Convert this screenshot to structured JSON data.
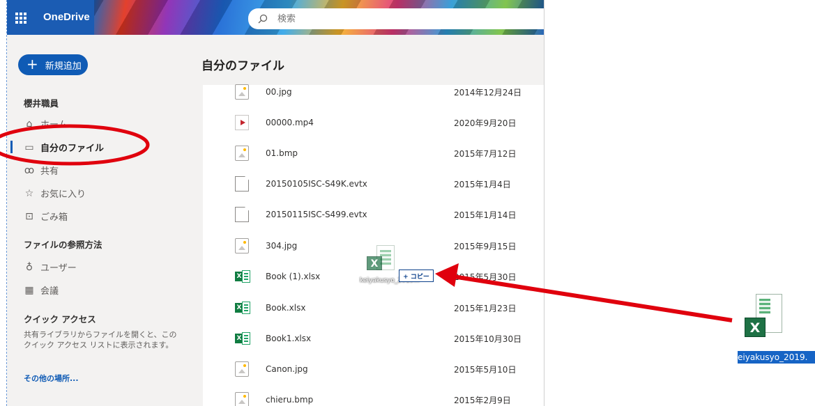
{
  "app": {
    "brand": "OneDrive"
  },
  "search": {
    "placeholder": "検索"
  },
  "new_button": {
    "label": "新規追加"
  },
  "sidebar": {
    "user_heading": "櫻井職員",
    "items": [
      {
        "label": "ホーム",
        "icon": "home-icon"
      },
      {
        "label": "自分のファイル",
        "icon": "folder-icon",
        "active": true
      },
      {
        "label": "共有",
        "icon": "people-icon"
      },
      {
        "label": "お気に入り",
        "icon": "star-icon"
      },
      {
        "label": "ごみ箱",
        "icon": "trash-icon"
      }
    ],
    "browse_heading": "ファイルの参照方法",
    "browse_items": [
      {
        "label": "ユーザー",
        "icon": "user-icon"
      },
      {
        "label": "会議",
        "icon": "meeting-icon"
      }
    ],
    "quick_heading": "クイック アクセス",
    "quick_desc": "共有ライブラリからファイルを開くと、このクイック アクセス リストに表示されます。",
    "other_link": "その他の場所..."
  },
  "main": {
    "title": "自分のファイル",
    "files": [
      {
        "name": "00.jpg",
        "date": "2014年12月24日",
        "type": "image"
      },
      {
        "name": "00000.mp4",
        "date": "2020年9月20日",
        "type": "video"
      },
      {
        "name": "01.bmp",
        "date": "2015年7月12日",
        "type": "image"
      },
      {
        "name": "20150105ISC-S49K.evtx",
        "date": "2015年1月4日",
        "type": "doc"
      },
      {
        "name": "20150115ISC-S499.evtx",
        "date": "2015年1月14日",
        "type": "doc"
      },
      {
        "name": "304.jpg",
        "date": "2015年9月15日",
        "type": "image"
      },
      {
        "name": "Book (1).xlsx",
        "date": "2015年5月30日",
        "type": "excel"
      },
      {
        "name": "Book.xlsx",
        "date": "2015年1月23日",
        "type": "excel"
      },
      {
        "name": "Book1.xlsx",
        "date": "2015年10月30日",
        "type": "excel"
      },
      {
        "name": "Canon.jpg",
        "date": "2015年5月10日",
        "type": "image"
      },
      {
        "name": "chieru.bmp",
        "date": "2015年2月9日",
        "type": "image"
      }
    ]
  },
  "drag": {
    "label": "keiyakusyo_2019...",
    "copy_tip": "+ コピー"
  },
  "desktop": {
    "label": "eiyakusyo_2019."
  },
  "colors": {
    "accent": "#0f5bb5",
    "annotation": "#e0000d",
    "excel": "#107c41"
  }
}
